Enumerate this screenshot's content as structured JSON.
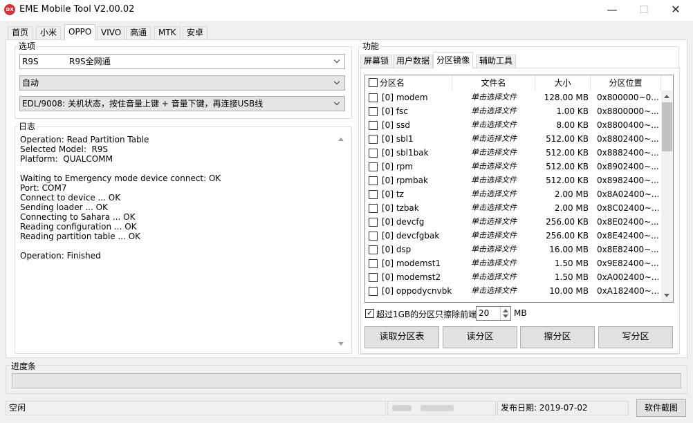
{
  "window": {
    "title": "EME Mobile Tool V2.00.02",
    "icon_text": "DX",
    "min": "—",
    "max": "☐",
    "close": "✕"
  },
  "tabs": [
    "首页",
    "小米",
    "OPPO",
    "VIVO",
    "高通",
    "MTK",
    "安卓"
  ],
  "active_tab": "OPPO",
  "options": {
    "label": "选项",
    "model_code": "R9S",
    "model_name": "R9S全网通",
    "mode": "自动",
    "connection": "EDL/9008: 关机状态，按住音量上键 + 音量下键，再连接USB线"
  },
  "log": {
    "label": "日志",
    "lines": [
      "Operation: Read Partition Table",
      "Selected Model:  R9S",
      "Platform:  QUALCOMM",
      "",
      "Waiting to Emergency mode device connect: OK",
      "Port: COM7",
      "Connect to device ... OK",
      "Sending loader ... OK",
      "Connecting to Sahara ... OK",
      "Reading configuration ... OK",
      "Reading partition table ... OK",
      "",
      "Operation: Finished"
    ]
  },
  "function": {
    "label": "功能",
    "subtabs": [
      "屏幕锁",
      "用户数据",
      "分区镜像",
      "辅助工具"
    ],
    "active_subtab": "分区镜像",
    "columns": {
      "name": "分区名",
      "file": "文件名",
      "size": "大小",
      "location": "分区位置"
    },
    "rows": [
      {
        "name": "[0] modem",
        "file": "单击选择文件",
        "size": "128.00 MB",
        "location": "0x800000~0..."
      },
      {
        "name": "[0] fsc",
        "file": "单击选择文件",
        "size": "1.00 KB",
        "location": "0x8800000~..."
      },
      {
        "name": "[0] ssd",
        "file": "单击选择文件",
        "size": "8.00 KB",
        "location": "0x8800400~..."
      },
      {
        "name": "[0] sbl1",
        "file": "单击选择文件",
        "size": "512.00 KB",
        "location": "0x8802400~..."
      },
      {
        "name": "[0] sbl1bak",
        "file": "单击选择文件",
        "size": "512.00 KB",
        "location": "0x8882400~..."
      },
      {
        "name": "[0] rpm",
        "file": "单击选择文件",
        "size": "512.00 KB",
        "location": "0x8902400~..."
      },
      {
        "name": "[0] rpmbak",
        "file": "单击选择文件",
        "size": "512.00 KB",
        "location": "0x8982400~..."
      },
      {
        "name": "[0] tz",
        "file": "单击选择文件",
        "size": "2.00 MB",
        "location": "0x8A02400~..."
      },
      {
        "name": "[0] tzbak",
        "file": "单击选择文件",
        "size": "2.00 MB",
        "location": "0x8C02400~..."
      },
      {
        "name": "[0] devcfg",
        "file": "单击选择文件",
        "size": "256.00 KB",
        "location": "0x8E02400~..."
      },
      {
        "name": "[0] devcfgbak",
        "file": "单击选择文件",
        "size": "256.00 KB",
        "location": "0x8E42400~..."
      },
      {
        "name": "[0] dsp",
        "file": "单击选择文件",
        "size": "16.00 MB",
        "location": "0x8E82400~..."
      },
      {
        "name": "[0] modemst1",
        "file": "单击选择文件",
        "size": "1.50 MB",
        "location": "0x9E82400~..."
      },
      {
        "name": "[0] modemst2",
        "file": "单击选择文件",
        "size": "1.50 MB",
        "location": "0xA002400~..."
      },
      {
        "name": "[0] oppodycnvbk",
        "file": "单击选择文件",
        "size": "10.00 MB",
        "location": "0xA182400~..."
      }
    ],
    "erase_limit_label": "超过1GB的分区只擦除前端",
    "erase_limit_value": "20",
    "erase_limit_unit": "MB",
    "buttons": {
      "read_table": "读取分区表",
      "read": "读分区",
      "erase": "擦分区",
      "write": "写分区"
    }
  },
  "progress": {
    "label": "进度条",
    "value": 0
  },
  "status": {
    "state": "空闲",
    "release_date": "发布日期: 2019-07-02",
    "screenshot_button": "软件截图"
  }
}
